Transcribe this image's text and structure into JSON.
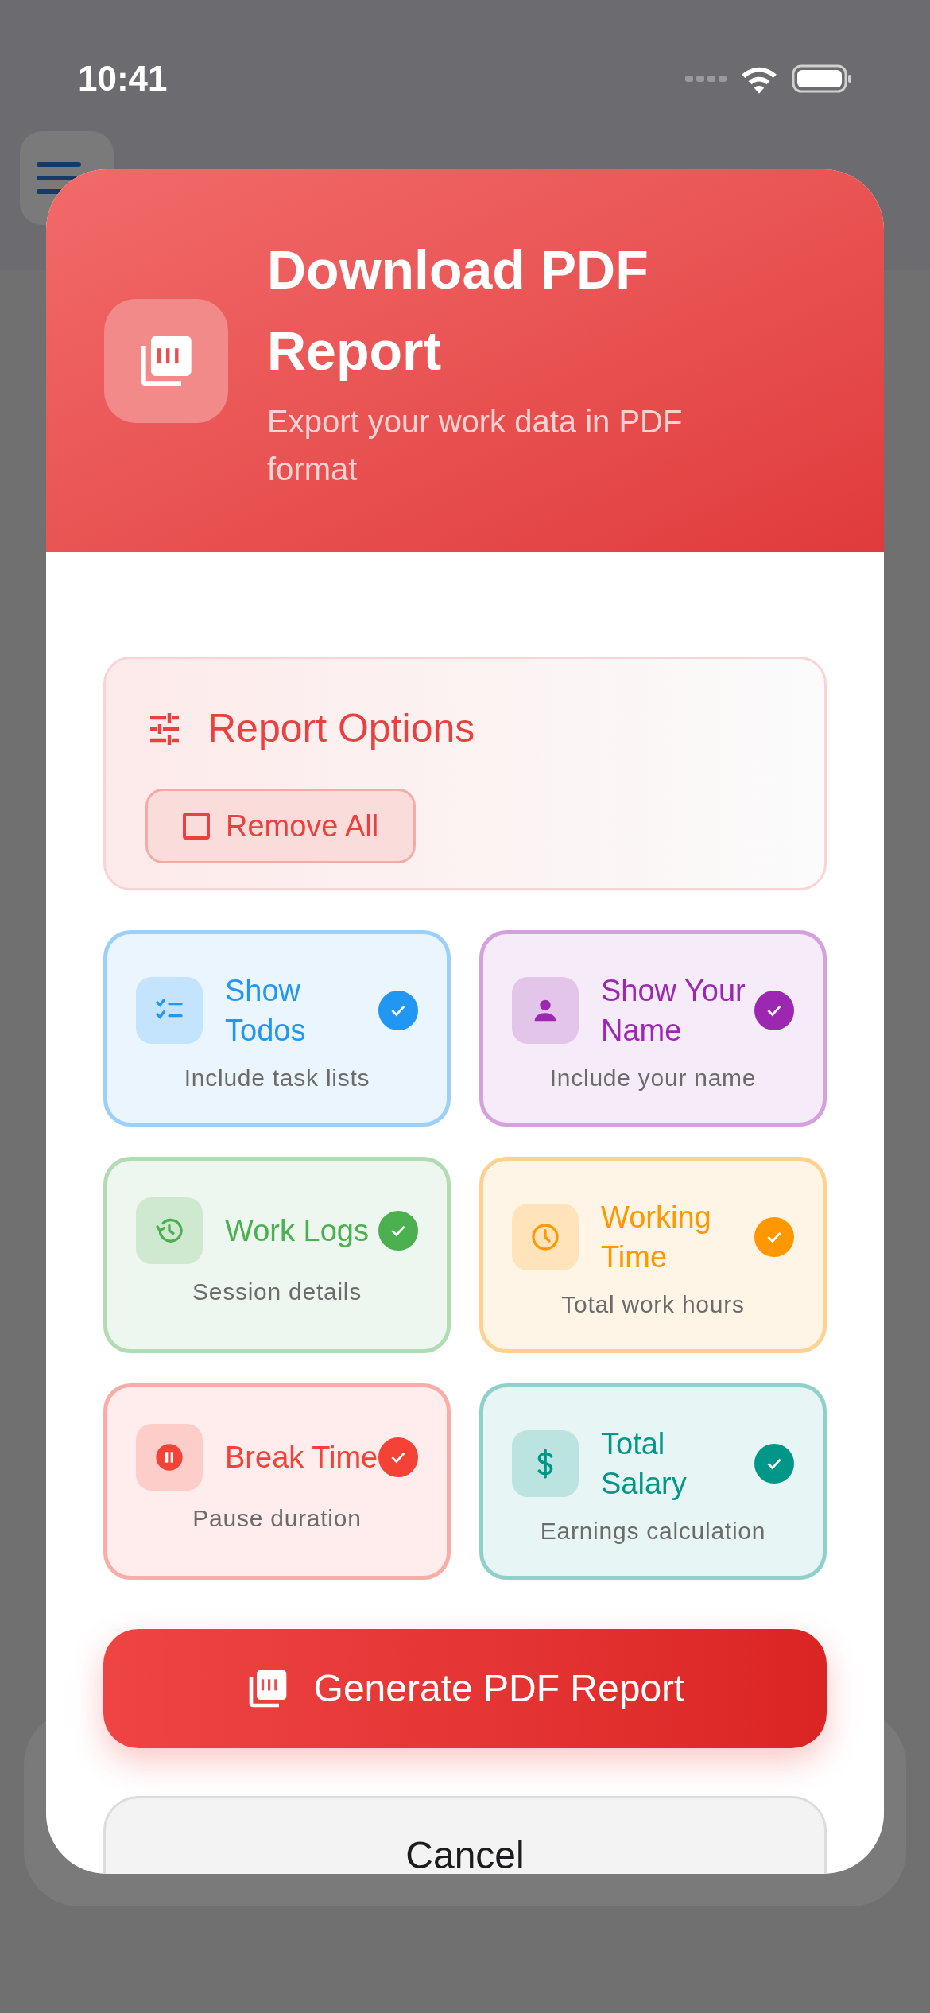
{
  "status_bar": {
    "time": "10:41"
  },
  "dialog": {
    "title": "Download PDF Report",
    "subtitle": "Export your work data in PDF format",
    "report_options": {
      "title": "Report Options",
      "remove_all": {
        "label": "Remove All",
        "checked": false
      }
    },
    "options": [
      {
        "title": "Show Todos",
        "subtitle": "Include task lists",
        "checked": true,
        "color": "#2196f3"
      },
      {
        "title": "Show Your Name",
        "subtitle": "Include your name",
        "checked": true,
        "color": "#9c27b0"
      },
      {
        "title": "Work Logs",
        "subtitle": "Session details",
        "checked": true,
        "color": "#4caf50"
      },
      {
        "title": "Working Time",
        "subtitle": "Total work hours",
        "checked": true,
        "color": "#ff9800"
      },
      {
        "title": "Break Time",
        "subtitle": "Pause duration",
        "checked": true,
        "color": "#f44336"
      },
      {
        "title": "Total Salary",
        "subtitle": "Earnings calculation",
        "checked": true,
        "color": "#009688"
      }
    ],
    "buttons": [
      "Generate PDF Report",
      "Cancel"
    ]
  }
}
